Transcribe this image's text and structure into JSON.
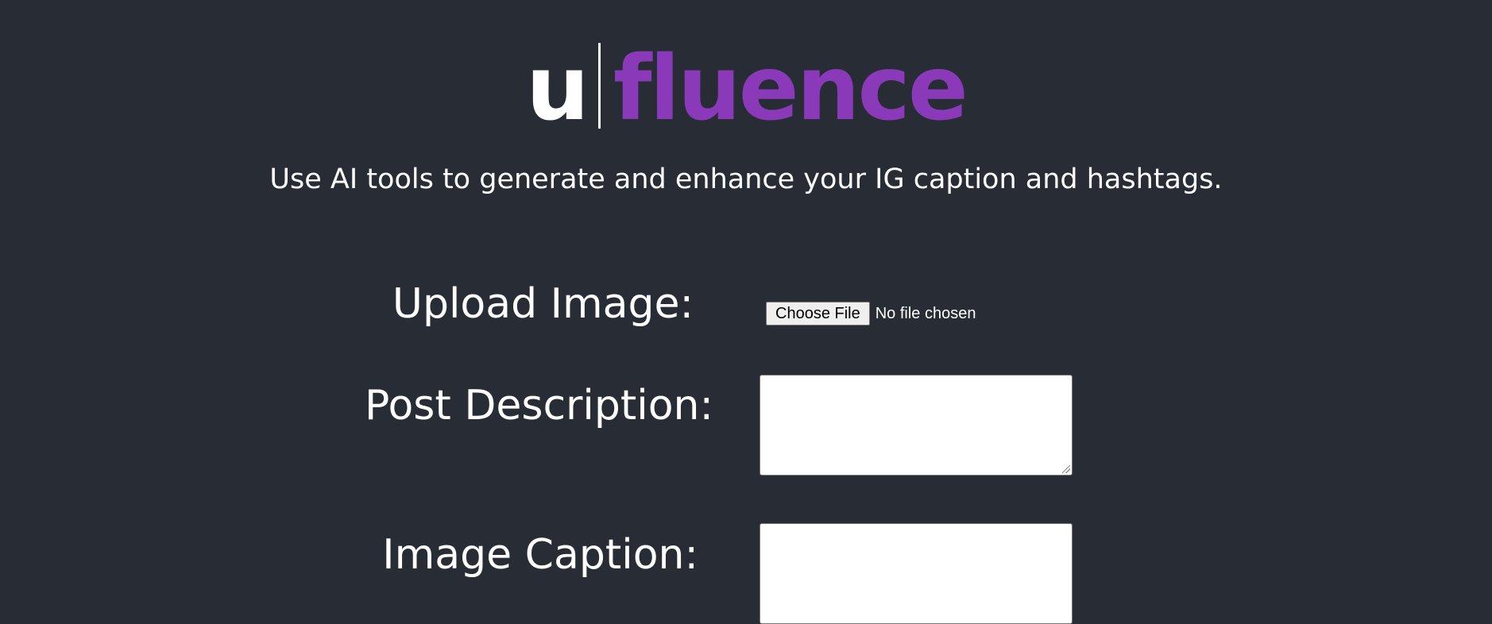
{
  "logo": {
    "left": "u",
    "right": "fluence"
  },
  "subtitle": "Use AI tools to generate and enhance your IG caption and hashtags.",
  "form": {
    "upload_label": "Upload Image:",
    "file_button": "Choose File",
    "file_status": "No file chosen",
    "description_label": "Post Description:",
    "description_value": "",
    "caption_label": "Image Caption:",
    "caption_value": ""
  },
  "colors": {
    "background": "#282c35",
    "accent": "#8a3ab9",
    "text": "#ffffff"
  }
}
